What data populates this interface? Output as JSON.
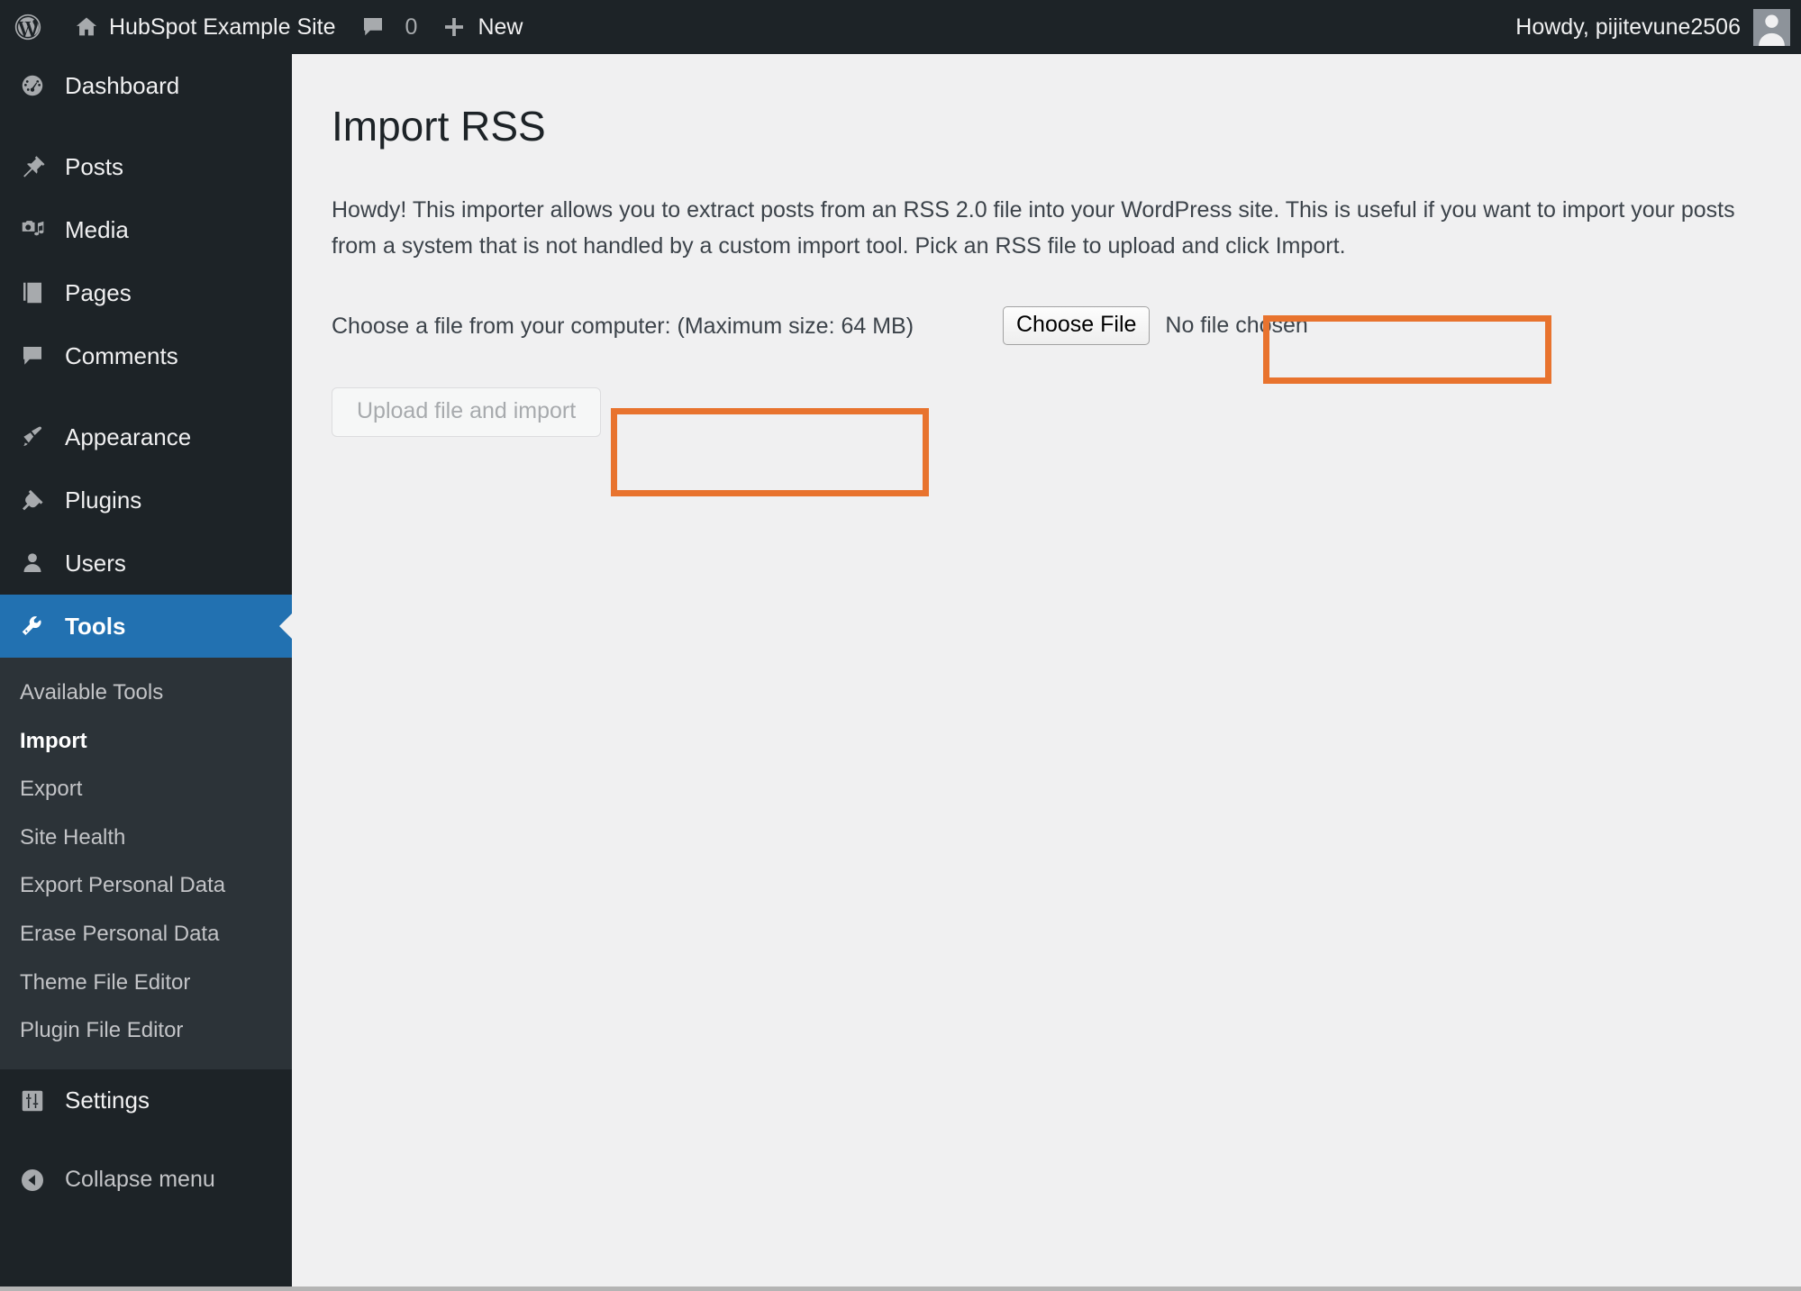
{
  "adminbar": {
    "wp_logo_icon": "wordpress-logo-icon",
    "site_home_icon": "home-icon",
    "site_name": "HubSpot Example Site",
    "comments_icon": "comment-bubble-icon",
    "comments_count": "0",
    "new_icon": "plus-icon",
    "new_label": "New",
    "howdy": "Howdy, pijitevune2506",
    "avatar_icon": "user-avatar-icon"
  },
  "sidebar": {
    "items": [
      {
        "label": "Dashboard",
        "icon": "dashboard-gauge-icon",
        "current": false
      },
      {
        "label": "Posts",
        "icon": "pushpin-icon",
        "current": false
      },
      {
        "label": "Media",
        "icon": "media-camera-music-icon",
        "current": false
      },
      {
        "label": "Pages",
        "icon": "pages-stack-icon",
        "current": false
      },
      {
        "label": "Comments",
        "icon": "comment-bubble-icon",
        "current": false
      },
      {
        "label": "Appearance",
        "icon": "paintbrush-icon",
        "current": false
      },
      {
        "label": "Plugins",
        "icon": "plug-icon",
        "current": false
      },
      {
        "label": "Users",
        "icon": "user-icon",
        "current": false
      },
      {
        "label": "Tools",
        "icon": "wrench-icon",
        "current": true
      },
      {
        "label": "Settings",
        "icon": "sliders-icon",
        "current": false
      }
    ],
    "tools_submenu": [
      {
        "label": "Available Tools",
        "current": false
      },
      {
        "label": "Import",
        "current": true
      },
      {
        "label": "Export",
        "current": false
      },
      {
        "label": "Site Health",
        "current": false
      },
      {
        "label": "Export Personal Data",
        "current": false
      },
      {
        "label": "Erase Personal Data",
        "current": false
      },
      {
        "label": "Theme File Editor",
        "current": false
      },
      {
        "label": "Plugin File Editor",
        "current": false
      }
    ],
    "collapse": {
      "label": "Collapse menu",
      "icon": "chevron-left-circle-icon"
    }
  },
  "main": {
    "title": "Import RSS",
    "intro": "Howdy! This importer allows you to extract posts from an RSS 2.0 file into your WordPress site. This is useful if you want to import your posts from a system that is not handled by a custom import tool. Pick an RSS file to upload and click Import.",
    "file_label": "Choose a file from your computer: (Maximum size: 64 MB)",
    "choose_file_button": "Choose File",
    "no_file_chosen": "No file chosen",
    "submit_button": "Upload file and import"
  },
  "colors": {
    "highlight": "#e8732e",
    "admin_blue": "#2271b1",
    "sidebar_bg": "#1d2327",
    "submenu_bg": "#2c3338",
    "content_bg": "#f0f0f1"
  }
}
